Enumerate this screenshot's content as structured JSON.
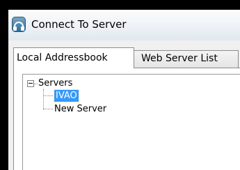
{
  "window": {
    "title": "Connect To Server",
    "app_icon": "headset-icon"
  },
  "tabs": [
    {
      "label": "Local Addressbook",
      "selected": true
    },
    {
      "label": "Web Server List",
      "selected": false
    }
  ],
  "tree": {
    "root": {
      "label": "Servers",
      "expanded": true,
      "expander_icon": "minus-box-icon"
    },
    "children": [
      {
        "label": "IVAO",
        "selected": true
      },
      {
        "label": "New Server",
        "selected": false
      }
    ]
  },
  "colors": {
    "selection": "#3399ff",
    "selection_text": "#ffffff",
    "background": "#000000"
  }
}
